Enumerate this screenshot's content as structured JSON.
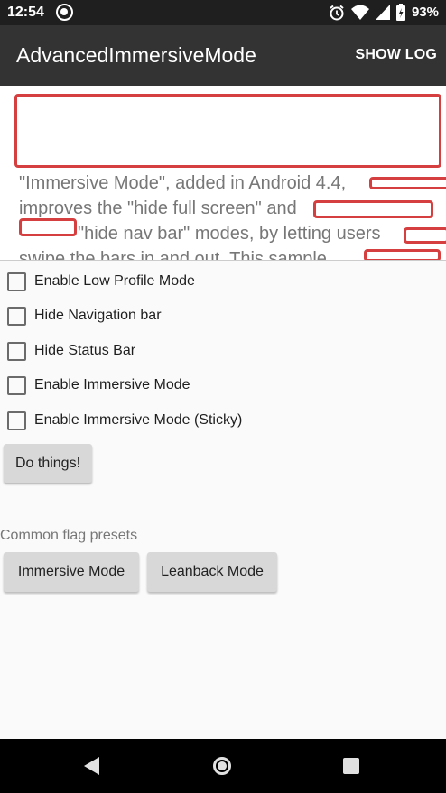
{
  "status_bar": {
    "time": "12:54",
    "battery": "93%",
    "icons": [
      "at-sign-icon",
      "alarm-icon",
      "wifi-icon",
      "signal-icon",
      "battery-icon"
    ]
  },
  "app_bar": {
    "title": "AdvancedImmersiveMode",
    "action": "SHOW LOG"
  },
  "intro": {
    "line1": "\"Immersive Mode\", added in Android 4.4,",
    "line2": "improves the \"hide full screen\" and",
    "line3": "\"hide nav bar\" modes, by letting users",
    "line4": "swipe the bars in and out.  This sample"
  },
  "options": [
    {
      "label": "Enable Low Profile Mode",
      "checked": false
    },
    {
      "label": "Hide Navigation bar",
      "checked": false
    },
    {
      "label": "Hide Status Bar",
      "checked": false
    },
    {
      "label": "Enable Immersive Mode",
      "checked": false
    },
    {
      "label": "Enable Immersive Mode (Sticky)",
      "checked": false
    }
  ],
  "do_things_label": "Do things!",
  "presets": {
    "heading": "Common flag presets",
    "immersive_label": "Immersive Mode",
    "leanback_label": "Leanback Mode"
  },
  "colors": {
    "app_bar": "#333333",
    "redaction": "#d63f3f",
    "button": "#d8d8d8"
  }
}
